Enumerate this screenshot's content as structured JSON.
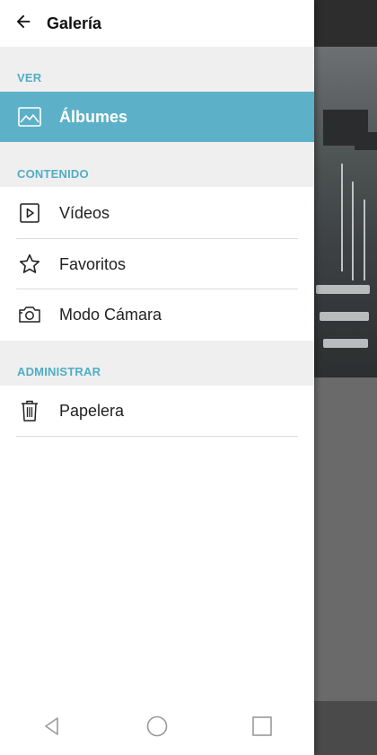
{
  "header": {
    "title": "Galería",
    "back_icon": "arrow-left-icon"
  },
  "sections": {
    "ver": {
      "label": "VER",
      "items": [
        {
          "label": "Álbumes",
          "icon": "image-icon",
          "selected": true
        }
      ]
    },
    "contenido": {
      "label": "CONTENIDO",
      "items": [
        {
          "label": "Vídeos",
          "icon": "video-play-icon"
        },
        {
          "label": "Favoritos",
          "icon": "star-icon"
        },
        {
          "label": "Modo Cámara",
          "icon": "camera-icon"
        }
      ]
    },
    "administrar": {
      "label": "ADMINISTRAR",
      "items": [
        {
          "label": "Papelera",
          "icon": "trash-icon"
        }
      ]
    }
  },
  "colors": {
    "accent": "#5cb1c8",
    "section_label": "#51adc4",
    "section_bg": "#efefef"
  },
  "navbar": {
    "buttons": [
      "back-triangle-icon",
      "home-circle-icon",
      "recents-square-icon"
    ]
  }
}
